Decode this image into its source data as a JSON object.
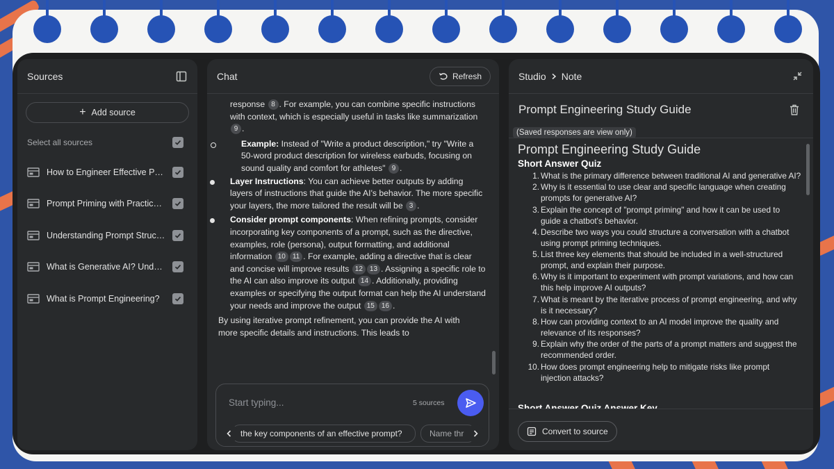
{
  "sources": {
    "title": "Sources",
    "add_label": "Add source",
    "select_all_label": "Select all sources",
    "items": [
      {
        "label": "How to Engineer Effective Pro..."
      },
      {
        "label": "Prompt Priming with Practical ..."
      },
      {
        "label": "Understanding Prompt Structu..."
      },
      {
        "label": "What is Generative AI? Unders..."
      },
      {
        "label": "What is Prompt Engineering?"
      }
    ]
  },
  "chat": {
    "title": "Chat",
    "refresh_label": "Refresh",
    "p1a": "response",
    "p1b": ". For example, you can combine specific instructions with context, which is especially useful in tasks like summarization",
    "ex_label": "Example:",
    "ex_text": " Instead of \"Write a product description,\" try \"Write a 50-word product description for wireless earbuds, focusing on sound quality and comfort for athletes\"",
    "layer_label": "Layer Instructions",
    "layer_text": ": You can achieve better outputs by adding layers of instructions that guide the AI's behavior. The more specific your layers, the more tailored the result will be",
    "consider_label": "Consider prompt components",
    "consider_t1": ": When refining prompts, consider incorporating key components of a prompt, such as the directive, examples, role (persona), output formatting, and additional information",
    "consider_t2": ". For example, adding a directive that is clear and concise will improve results",
    "consider_t3": ". Assigning a specific role to the AI can also improve its output",
    "consider_t4": ". Additionally, providing examples or specifying the output format can help the AI understand your needs and improve the output",
    "final_text": "By using iterative prompt refinement, you can provide the AI with more specific details and instructions. This leads to",
    "cites": [
      "8",
      "9",
      "9",
      "3",
      "10",
      "11",
      "12",
      "13",
      "14",
      "15",
      "16"
    ],
    "input_placeholder": "Start typing...",
    "source_count": "5 sources",
    "suggestion_1": "the key components of an effective prompt?",
    "suggestion_2": "Name thr"
  },
  "studio": {
    "breadcrumb_root": "Studio",
    "breadcrumb_leaf": "Note",
    "note_title": "Prompt Engineering Study Guide",
    "view_only": "(Saved responses are view only)",
    "heading": "Prompt Engineering Study Guide",
    "quiz_heading": "Short Answer Quiz",
    "key_heading": "Short Answer Quiz Answer Key",
    "questions": [
      "What is the primary difference between traditional AI and generative AI?",
      "Why is it essential to use clear and specific language when creating prompts for generative AI?",
      "Explain the concept of \"prompt priming\" and how it can be used to guide a chatbot's behavior.",
      "Describe two ways you could structure a conversation with a chatbot using prompt priming techniques.",
      "List three key elements that should be included in a well-structured prompt, and explain their purpose.",
      "Why is it important to experiment with prompt variations, and how can this help improve AI outputs?",
      "What is meant by the iterative process of prompt engineering, and why is it necessary?",
      "How can providing context to an AI model improve the quality and relevance of its responses?",
      "Explain why the order of the parts of a prompt matters and suggest the recommended order.",
      "How does prompt engineering help to mitigate risks like prompt injection attacks?"
    ],
    "question_numbers": [
      "1.",
      "2.",
      "3.",
      "4.",
      "5.",
      "6.",
      "7.",
      "8.",
      "9.",
      "10."
    ],
    "convert_label": "Convert to source"
  },
  "colors": {
    "accent": "#4a5cf0",
    "panel": "#282a2c",
    "background": "#2f55a8",
    "stripe": "#e8744a"
  }
}
